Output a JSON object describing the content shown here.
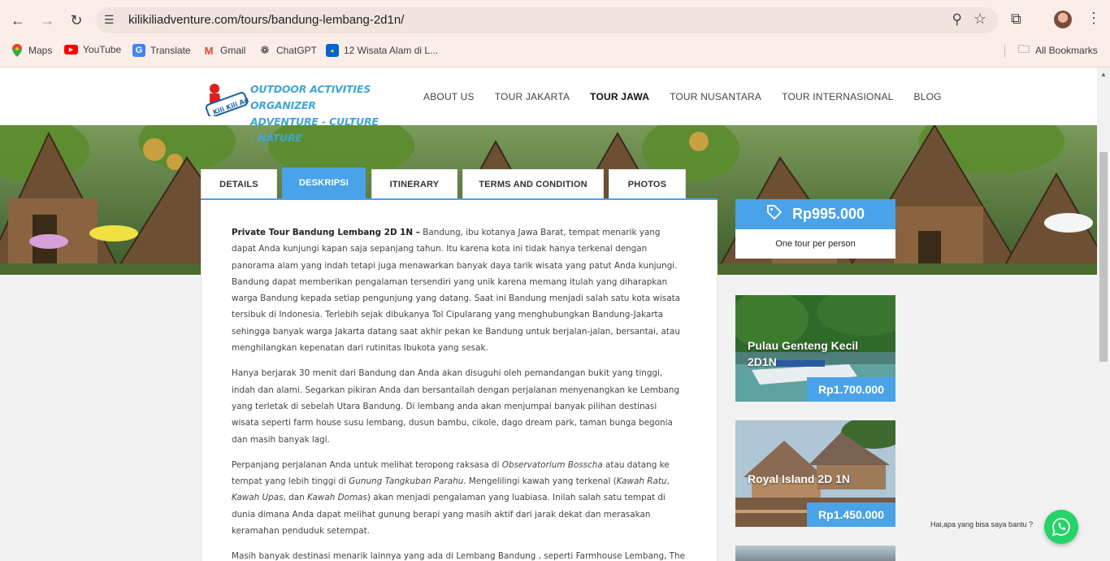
{
  "browser": {
    "url": "kilikiliadventure.com/tours/bandung-lembang-2d1n/",
    "bookmarks": [
      {
        "label": "Maps",
        "icon": "maps-icon"
      },
      {
        "label": "YouTube",
        "icon": "youtube-icon"
      },
      {
        "label": "Translate",
        "icon": "translate-icon"
      },
      {
        "label": "Gmail",
        "icon": "gmail-icon"
      },
      {
        "label": "ChatGPT",
        "icon": "chatgpt-icon"
      },
      {
        "label": "12 Wisata Alam di L...",
        "icon": "tiket-icon"
      }
    ],
    "all_bookmarks": "All Bookmarks"
  },
  "site": {
    "logo_badge": "Kili Kili Adventure",
    "logo_line1": "OUTDOOR ACTIVITIES ORGANIZER",
    "logo_line2": "ADVENTURE - CULTURE - NATURE",
    "nav": [
      "ABOUT US",
      "TOUR JAKARTA",
      "TOUR JAWA",
      "TOUR NUSANTARA",
      "TOUR INTERNASIONAL",
      "BLOG"
    ],
    "active_nav": "TOUR JAWA"
  },
  "tabs": [
    "DETAILS",
    "DESKRIPSI",
    "ITINERARY",
    "TERMS AND CONDITION",
    "PHOTOS"
  ],
  "active_tab": "DESKRIPSI",
  "description": {
    "p1_strong": "Private Tour Bandung Lembang 2D 1N –",
    "p1": " Bandung, ibu kotanya Jawa Barat, tempat menarik yang dapat Anda kunjungi kapan saja sepanjang tahun. Itu karena kota ini tidak hanya terkenal dengan panorama alam yang indah tetapi  juga menawarkan banyak daya tarik wisata yang patut Anda kunjungi. Bandung dapat memberikan pengalaman tersendiri yang unik karena memang itulah yang diharapkan warga Bandung kepada setiap pengunjung yang datang. Saat ini Bandung menjadi salah satu kota wisata tersibuk di Indonesia. Terlebih sejak dibukanya Tol Cipularang yang menghubungkan Bandung-Jakarta sehingga banyak warga Jakarta datang saat akhir pekan ke Bandung untuk berjalan-jalan, bersantai, atau menghilangkan kepenatan dari rutinitas Ibukota yang sesak.",
    "p2": "Hanya berjarak 30 menit dari Bandung dan Anda akan disuguhi oleh pemandangan bukit yang  tinggi, indah dan alami. Segarkan pikiran Anda dan bersantailah dengan perjalanan menyenangkan ke Lembang yang terletak di sebelah Utara Bandung. Di lembang anda akan menjumpai banyak pilihan destinasi wisata seperti farm house susu lembang, dusun bambu, cikole, dago dream park, taman bunga begonia dan masih banyak lagi.",
    "p3_a": "Perpanjang perjalanan Anda untuk melihat teropong raksasa di ",
    "p3_em1": "Observatorium Bosscha",
    "p3_b": " atau datang ke tempat yang lebih tinggi di ",
    "p3_em2": "Gunung Tangkuban Parahu",
    "p3_c": ". Mengelilingi kawah yang terkenal (",
    "p3_em3": "Kawah Ratu",
    "p3_d": ", ",
    "p3_em4": "Kawah Upas",
    "p3_e": ", dan ",
    "p3_em5": "Kawah Domas",
    "p3_f": ") akan menjadi pengalaman yang luabiasa. Inilah salah satu tempat di dunia dimana Anda dapat melihat gunung berapi yang masih aktif dari jarak dekat dan merasakan keramahan penduduk setempat.",
    "p4": "Masih banyak destinasi menarik lainnya yang ada di Lembang Bandung , seperti  Farmhouse Lembang, The Great Asia Africa, Lembang Wonderland, D'Ranch Sari Ater, Floating Market Lembang, Dusun Bambu dan"
  },
  "price": {
    "amount": "Rp995.000",
    "note": "One tour per person"
  },
  "related": [
    {
      "title": "Pulau Genteng Kecil 2D1N",
      "price": "Rp1.700.000"
    },
    {
      "title": "Royal Island 2D 1N",
      "price": "Rp1.450.000"
    }
  ],
  "whatsapp": {
    "text": "Hai,apa yang bisa saya bantu ?"
  },
  "colors": {
    "accent": "#4aa3e8",
    "whatsapp": "#25d366",
    "logo": "#3da7d6"
  }
}
